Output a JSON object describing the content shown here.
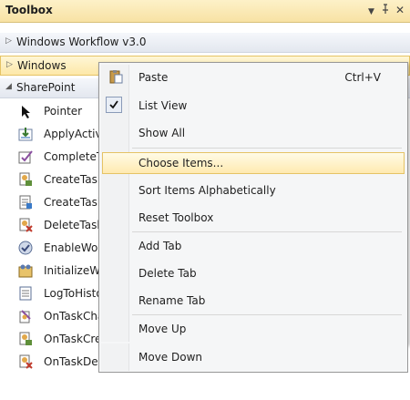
{
  "window": {
    "title": "Toolbox",
    "controls": {
      "dropdown": "▼",
      "pin": "ꟷ",
      "close": "✕"
    }
  },
  "tabs": [
    {
      "label": "Windows Workflow v3.0",
      "expanded": false
    },
    {
      "label": "Windows",
      "expanded": false
    },
    {
      "label": "SharePoint",
      "expanded": true
    }
  ],
  "tools": [
    {
      "label": "Pointer",
      "icon": "pointer-icon"
    },
    {
      "label": "ApplyActivation",
      "icon": "apply-activation-icon"
    },
    {
      "label": "CompleteTask",
      "icon": "complete-task-icon"
    },
    {
      "label": "CreateTask",
      "icon": "create-task-icon"
    },
    {
      "label": "CreateTaskWithContentType",
      "icon": "create-task-content-type-icon"
    },
    {
      "label": "DeleteTask",
      "icon": "delete-task-icon"
    },
    {
      "label": "EnableWorkflowModification",
      "icon": "enable-modification-icon"
    },
    {
      "label": "InitializeWorkflow",
      "icon": "initialize-workflow-icon"
    },
    {
      "label": "LogToHistoryListActivity",
      "icon": "log-history-icon"
    },
    {
      "label": "OnTaskChanged",
      "icon": "on-task-changed-icon"
    },
    {
      "label": "OnTaskCreated",
      "icon": "on-task-created-icon"
    },
    {
      "label": "OnTaskDeleted",
      "icon": "on-task-deleted-icon"
    }
  ],
  "context_menu": {
    "items": [
      {
        "label": "Paste",
        "shortcut": "Ctrl+V",
        "icon": "paste-icon"
      },
      {
        "label": "List View",
        "checked": true
      },
      {
        "label": "Show All"
      },
      {
        "label": "Choose Items...",
        "highlighted": true
      },
      {
        "label": "Sort Items Alphabetically"
      },
      {
        "label": "Reset Toolbox"
      },
      {
        "label": "Add Tab"
      },
      {
        "label": "Delete Tab"
      },
      {
        "label": "Rename Tab"
      },
      {
        "label": "Move Up"
      },
      {
        "label": "Move Down"
      }
    ]
  },
  "colors": {
    "title_bar": "#fde9a9",
    "highlight": "#ffeab0",
    "highlight_border": "#e5c365",
    "menu_background": "#f5f6f7"
  }
}
